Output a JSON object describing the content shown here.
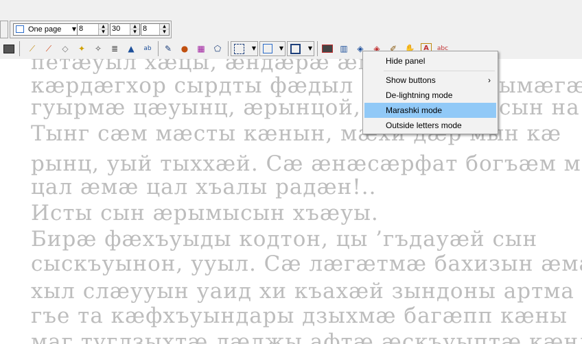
{
  "toolbar": {
    "view_mode": {
      "value": "One page"
    },
    "spinners": [
      {
        "name": "spinner-1",
        "value": "8"
      },
      {
        "name": "spinner-2",
        "value": "30"
      },
      {
        "name": "spinner-3",
        "value": "8"
      }
    ],
    "icons": [
      "image-icon",
      "broom-icon",
      "broom-red-icon",
      "eraser-icon",
      "magic-wand-icon",
      "wand-plus-icon",
      "stack-icon",
      "stamp-icon",
      "abc-replace-icon",
      "pen-icon",
      "palette-icon",
      "color-grid-icon",
      "polygon-icon",
      "select-rect-icon",
      "rect-icon",
      "rect-bold-icon",
      "screen-icon",
      "columns-icon",
      "tag-icon",
      "tag-red-icon",
      "pencil-icon",
      "hand-icon",
      "font-a-icon",
      "abc-check-icon"
    ]
  },
  "context_menu": {
    "items": [
      {
        "label": "Hide panel"
      },
      {
        "label": "Show buttons",
        "submenu": "›"
      },
      {
        "label": "De-lightning mode"
      },
      {
        "label": "Marashki mode",
        "selected": true
      },
      {
        "label": "Outside letters mode"
      }
    ]
  },
  "document": {
    "lines": [
      "петæуыл хæцы, æндæрæ æм",
      "кæрдæгхор  сырдты фæдыл",
      "гуырмæ  цæуынц, æрынцой,",
      "Тынг  сæм мæсты кæнын,  мæхи дæр мын кæ",
      "рынц, уый тыххæй. Сæ æнæсæрфат богъæм м",
      "цал æмæ цал хъалы радæн!..",
      "   Исты сын æрымысын хъæуы.",
      "   Бирæ фæхъуыды кодтон, цы ’гъдауæй сын",
      "сыскъуынон, ууыл. Сæ лæгæтмæ бахизын æма",
      "хыл слæууын уаид хи къахæй зындоны артма",
      "гъе та кæфхъуындары дзыхмæ багæпп кæны",
      "маг туглзыхтæ лæлжы афтæ æскъуыптæ кæнлæ"
    ],
    "fragments": {
      "right_1": "ымæгæ",
      "right_2": "сын   на"
    }
  }
}
